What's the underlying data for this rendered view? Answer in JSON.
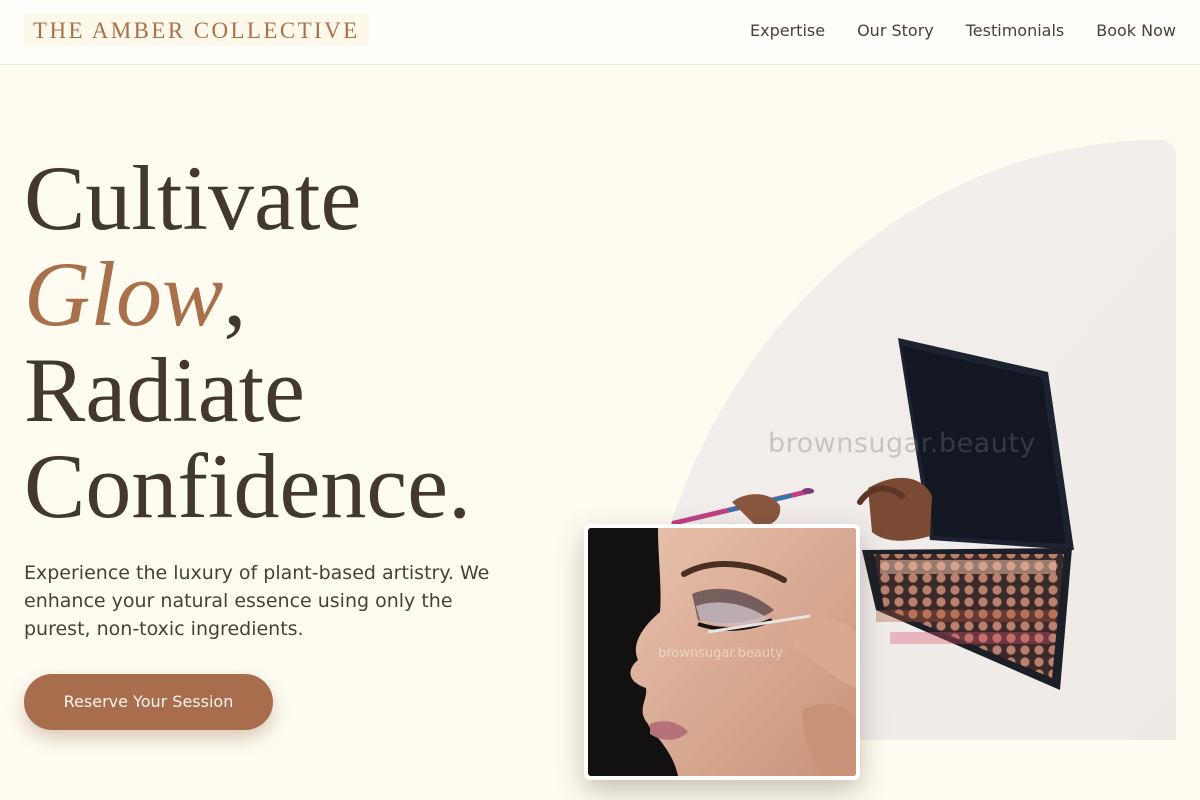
{
  "brand": {
    "name": "THE AMBER COLLECTIVE"
  },
  "nav": {
    "items": [
      {
        "label": "Expertise"
      },
      {
        "label": "Our Story"
      },
      {
        "label": "Testimonials"
      },
      {
        "label": "Book Now"
      }
    ]
  },
  "hero": {
    "title_line1": "Cultivate",
    "title_glow": "Glow",
    "title_comma": ",",
    "title_line3": "Radiate",
    "title_line4": "Confidence.",
    "intro": "Experience the luxury of plant-based artistry. We enhance your natural essence using only the purest, non-toxic ingredients.",
    "cta_label": "Reserve Your Session"
  },
  "images": {
    "main_watermark": "brownsugar.beauty",
    "inset_watermark": "brownsugar.beauty"
  },
  "colors": {
    "accent": "#a8714c",
    "button": "#a86d4d",
    "background": "#fefcf1",
    "text": "#433830"
  }
}
